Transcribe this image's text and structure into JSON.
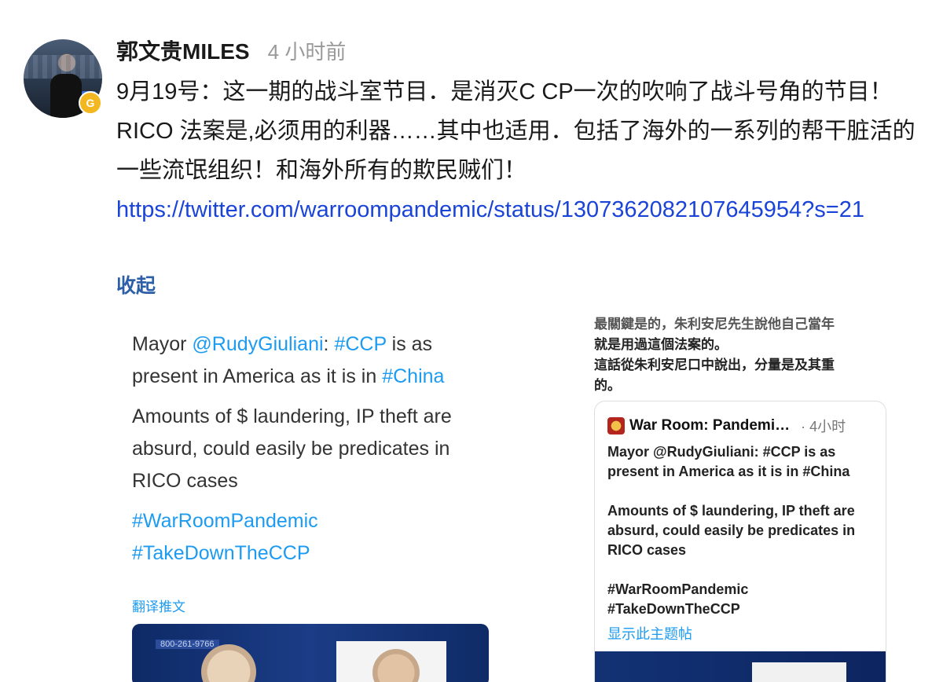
{
  "post": {
    "username": "郭文贵MILES",
    "time": "4 小时前",
    "text": "9月19号：这一期的战斗室节目．是消灭C CP一次的吹响了战斗号角的节目！RICO 法案是,必须用的利器……其中也适用．包括了海外的一系列的帮干脏活的一些流氓组织！和海外所有的欺民贼们！",
    "link": "https://twitter.com/warroompandemic/status/1307362082107645954?s=21",
    "collapse_label": "收起"
  },
  "left_image": {
    "mayor": "Mayor ",
    "handle": "@RudyGiuliani",
    "colon": ": ",
    "tag_ccp": "#CCP",
    "mid": " is as present in America as it is in ",
    "tag_china": "#China",
    "para2": "Amounts of $ laundering, IP theft are absurd, could easily be predicates in RICO cases",
    "tag1": "#WarRoomPandemic",
    "tag2": "#TakeDownTheCCP",
    "translate": "翻译推文",
    "banner": "800-261-9766"
  },
  "right_image": {
    "cn_line1": "最關鍵是的，朱利安尼先生說他自己當年",
    "cn_line2": "就是用過這個法案的。",
    "cn_line3": "這話從朱利安尼口中說出，分量是及其重",
    "cn_line4": "的。",
    "tweet_name": "War Room: Pandemi…",
    "tweet_time": "· 4小时",
    "tweet_p1": "Mayor @RudyGiuliani: #CCP is as present in America as it is in #China",
    "tweet_p2": "Amounts of $ laundering, IP theft are absurd, could easily be predicates in RICO cases",
    "tweet_tag1": "#WarRoomPandemic",
    "tweet_tag2": "#TakeDownTheCCP",
    "thread_label": "显示此主题帖"
  },
  "icons": {
    "badge": "G"
  }
}
